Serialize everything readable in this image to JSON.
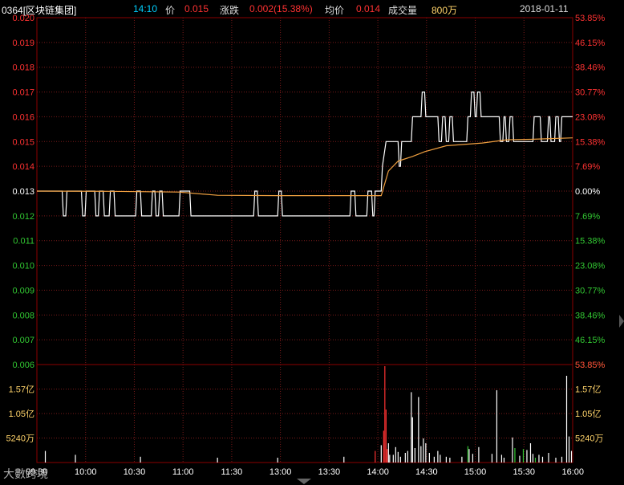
{
  "header": {
    "code_name": "0364[区块链集团]",
    "time": "14:10",
    "price_label": "价",
    "price_value": "0.015",
    "change_label": "涨跌",
    "change_value": "0.002(15.38%)",
    "avg_label": "均价",
    "avg_value": "0.014",
    "volume_label": "成交量",
    "volume_value": "800万",
    "date": "2018-01-11"
  },
  "watermark": "大數跨境",
  "colors": {
    "background": "#000000",
    "grid": "#7a1a1a",
    "axis_frame": "#8b0000",
    "up": "#ff3232",
    "down": "#32c832",
    "neutral": "#ffffff",
    "price_line": "#ffffff",
    "avg_line": "#f0a040",
    "volume_label": "#ffd36a",
    "time_label": "#ffffff",
    "header_code": "#ffffff",
    "header_time": "#00d0ff"
  },
  "chart_data": {
    "type": "line",
    "title": "",
    "xlabel": "",
    "ylabel": "",
    "price_axis": {
      "ticks": [
        "0.020",
        "0.019",
        "0.018",
        "0.017",
        "0.016",
        "0.015",
        "0.014",
        "0.013",
        "0.012",
        "0.011",
        "0.010",
        "0.009",
        "0.008",
        "0.007",
        "0.006"
      ],
      "ylim": [
        0.006,
        0.02
      ],
      "prev_close": 0.013
    },
    "pct_axis": {
      "ticks": [
        "53.85%",
        "46.15%",
        "38.46%",
        "30.77%",
        "23.08%",
        "15.38%",
        "7.69%",
        "0.00%",
        "7.69%",
        "15.38%",
        "23.08%",
        "30.77%",
        "38.46%",
        "46.15%",
        "53.85%"
      ]
    },
    "time_ticks": [
      "09:30",
      "10:00",
      "10:30",
      "11:00",
      "11:30",
      "13:00",
      "13:30",
      "14:00",
      "14:30",
      "15:00",
      "15:30",
      "16:00"
    ],
    "volume_axis": {
      "ticks": [
        "1.57亿",
        "1.05亿",
        "5240万"
      ],
      "max_label": "53.85%"
    },
    "series": [
      {
        "key": "price",
        "points": [
          [
            0,
            0.013
          ],
          [
            21,
            0.013
          ],
          [
            22,
            0.012
          ],
          [
            24,
            0.012
          ],
          [
            25,
            0.013
          ],
          [
            37,
            0.013
          ],
          [
            38,
            0.012
          ],
          [
            40,
            0.012
          ],
          [
            41,
            0.013
          ],
          [
            48,
            0.013
          ],
          [
            49,
            0.012
          ],
          [
            51,
            0.012
          ],
          [
            52,
            0.013
          ],
          [
            55,
            0.013
          ],
          [
            56,
            0.012
          ],
          [
            60,
            0.012
          ],
          [
            61,
            0.013
          ],
          [
            64,
            0.013
          ],
          [
            65,
            0.012
          ],
          [
            82,
            0.012
          ],
          [
            83,
            0.013
          ],
          [
            86,
            0.013
          ],
          [
            87,
            0.012
          ],
          [
            95,
            0.012
          ],
          [
            96,
            0.013
          ],
          [
            98,
            0.013
          ],
          [
            99,
            0.012
          ],
          [
            101,
            0.012
          ],
          [
            102,
            0.013
          ],
          [
            104,
            0.013
          ],
          [
            105,
            0.012
          ],
          [
            118,
            0.012
          ],
          [
            119,
            0.013
          ],
          [
            127,
            0.013
          ],
          [
            128,
            0.012
          ],
          [
            180,
            0.012
          ],
          [
            181,
            0.013
          ],
          [
            183,
            0.013
          ],
          [
            184,
            0.012
          ],
          [
            200,
            0.012
          ],
          [
            201,
            0.013
          ],
          [
            203,
            0.013
          ],
          [
            204,
            0.012
          ],
          [
            260,
            0.012
          ],
          [
            261,
            0.013
          ],
          [
            264,
            0.013
          ],
          [
            265,
            0.012
          ],
          [
            274,
            0.012
          ],
          [
            275,
            0.013
          ],
          [
            278,
            0.013
          ],
          [
            279,
            0.012
          ],
          [
            280,
            0.012
          ],
          [
            281,
            0.013
          ],
          [
            286,
            0.013
          ],
          [
            287,
            0.014
          ],
          [
            290,
            0.015
          ],
          [
            300,
            0.015
          ],
          [
            301,
            0.014
          ],
          [
            302,
            0.014
          ],
          [
            303,
            0.015
          ],
          [
            311,
            0.015
          ],
          [
            312,
            0.016
          ],
          [
            319,
            0.016
          ],
          [
            320,
            0.017
          ],
          [
            322,
            0.017
          ],
          [
            323,
            0.016
          ],
          [
            333,
            0.016
          ],
          [
            334,
            0.015
          ],
          [
            336,
            0.015
          ],
          [
            337,
            0.016
          ],
          [
            339,
            0.016
          ],
          [
            340,
            0.015
          ],
          [
            342,
            0.015
          ],
          [
            343,
            0.016
          ],
          [
            345,
            0.016
          ],
          [
            346,
            0.015
          ],
          [
            357,
            0.015
          ],
          [
            358,
            0.016
          ],
          [
            360,
            0.016
          ],
          [
            361,
            0.017
          ],
          [
            363,
            0.017
          ],
          [
            364,
            0.016
          ],
          [
            365,
            0.016
          ],
          [
            366,
            0.017
          ],
          [
            368,
            0.017
          ],
          [
            369,
            0.016
          ],
          [
            384,
            0.016
          ],
          [
            385,
            0.015
          ],
          [
            387,
            0.015
          ],
          [
            388,
            0.016
          ],
          [
            389,
            0.016
          ],
          [
            390,
            0.015
          ],
          [
            392,
            0.015
          ],
          [
            393,
            0.016
          ],
          [
            395,
            0.016
          ],
          [
            396,
            0.015
          ],
          [
            412,
            0.015
          ],
          [
            413,
            0.016
          ],
          [
            418,
            0.016
          ],
          [
            419,
            0.015
          ],
          [
            424,
            0.015
          ],
          [
            425,
            0.016
          ],
          [
            426,
            0.016
          ],
          [
            427,
            0.015
          ],
          [
            430,
            0.015
          ],
          [
            431,
            0.016
          ],
          [
            433,
            0.016
          ],
          [
            434,
            0.015
          ],
          [
            435,
            0.015
          ],
          [
            436,
            0.016
          ],
          [
            445,
            0.016
          ]
        ]
      },
      {
        "key": "average",
        "points": [
          [
            0,
            0.013
          ],
          [
            60,
            0.01299
          ],
          [
            118,
            0.01296
          ],
          [
            150,
            0.01283
          ],
          [
            200,
            0.01282
          ],
          [
            260,
            0.01282
          ],
          [
            286,
            0.01282
          ],
          [
            292,
            0.01381
          ],
          [
            300,
            0.01421
          ],
          [
            312,
            0.0144
          ],
          [
            322,
            0.01459
          ],
          [
            340,
            0.01483
          ],
          [
            370,
            0.01494
          ],
          [
            390,
            0.01507
          ],
          [
            410,
            0.01509
          ],
          [
            445,
            0.01515
          ]
        ]
      }
    ],
    "volume_bars": [
      [
        7,
        0.12,
        "neutral"
      ],
      [
        32,
        0.08,
        "neutral"
      ],
      [
        86,
        0.06,
        "neutral"
      ],
      [
        150,
        0.05,
        "neutral"
      ],
      [
        200,
        0.05,
        "neutral"
      ],
      [
        255,
        0.06,
        "neutral"
      ],
      [
        281,
        0.12,
        "up"
      ],
      [
        286,
        0.18,
        "neutral"
      ],
      [
        288,
        0.33,
        "up"
      ],
      [
        289,
        1.0,
        "up"
      ],
      [
        290,
        0.55,
        "up"
      ],
      [
        291,
        0.14,
        "up"
      ],
      [
        292,
        0.2,
        "neutral"
      ],
      [
        293,
        0.08,
        "neutral"
      ],
      [
        296,
        0.08,
        "neutral"
      ],
      [
        298,
        0.16,
        "neutral"
      ],
      [
        300,
        0.11,
        "neutral"
      ],
      [
        302,
        0.06,
        "neutral"
      ],
      [
        306,
        0.1,
        "neutral"
      ],
      [
        308,
        0.12,
        "neutral"
      ],
      [
        311,
        0.73,
        "neutral"
      ],
      [
        312,
        0.47,
        "neutral"
      ],
      [
        314,
        0.15,
        "neutral"
      ],
      [
        317,
        0.68,
        "neutral"
      ],
      [
        319,
        0.17,
        "neutral"
      ],
      [
        321,
        0.25,
        "neutral"
      ],
      [
        323,
        0.2,
        "neutral"
      ],
      [
        326,
        0.1,
        "neutral"
      ],
      [
        330,
        0.06,
        "neutral"
      ],
      [
        333,
        0.12,
        "neutral"
      ],
      [
        335,
        0.08,
        "neutral"
      ],
      [
        340,
        0.06,
        "neutral"
      ],
      [
        343,
        0.05,
        "neutral"
      ],
      [
        353,
        0.06,
        "neutral"
      ],
      [
        358,
        0.17,
        "down"
      ],
      [
        359,
        0.14,
        "neutral"
      ],
      [
        362,
        0.09,
        "neutral"
      ],
      [
        367,
        0.16,
        "neutral"
      ],
      [
        378,
        0.09,
        "neutral"
      ],
      [
        382,
        0.75,
        "neutral"
      ],
      [
        386,
        0.08,
        "neutral"
      ],
      [
        388,
        0.05,
        "neutral"
      ],
      [
        395,
        0.26,
        "neutral"
      ],
      [
        397,
        0.15,
        "down"
      ],
      [
        401,
        0.07,
        "neutral"
      ],
      [
        404,
        0.14,
        "down"
      ],
      [
        407,
        0.13,
        "neutral"
      ],
      [
        410,
        0.2,
        "neutral"
      ],
      [
        412,
        0.09,
        "neutral"
      ],
      [
        414,
        0.05,
        "down"
      ],
      [
        417,
        0.08,
        "neutral"
      ],
      [
        420,
        0.06,
        "neutral"
      ],
      [
        425,
        0.1,
        "neutral"
      ],
      [
        431,
        0.05,
        "neutral"
      ],
      [
        436,
        0.06,
        "neutral"
      ],
      [
        440,
        0.9,
        "neutral"
      ],
      [
        442,
        0.27,
        "neutral"
      ],
      [
        444,
        0.12,
        "neutral"
      ]
    ]
  }
}
